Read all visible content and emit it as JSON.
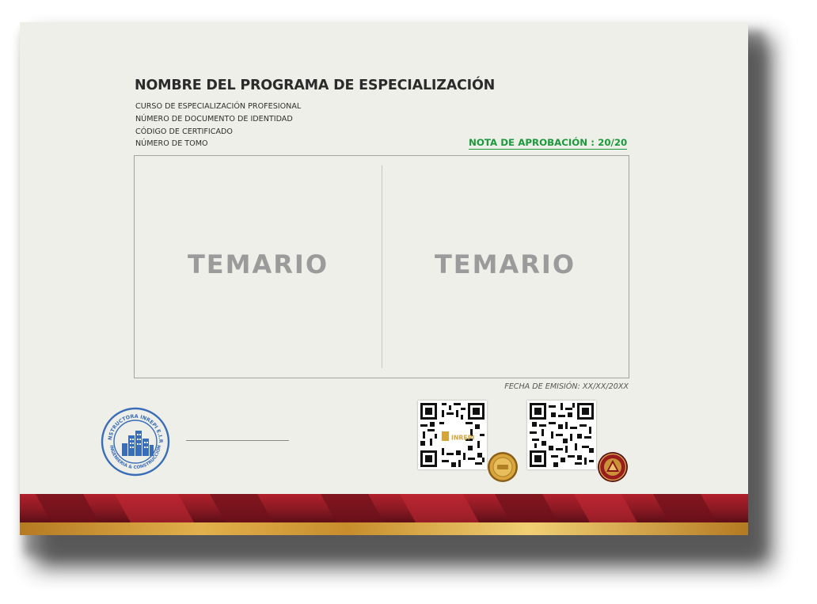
{
  "certificate": {
    "title": "NOMBRE DEL PROGRAMA DE ESPECIALIZACIÓN",
    "lines": [
      "CURSO DE ESPECIALIZACIÓN PROFESIONAL",
      "NÚMERO DE DOCUMENTO DE IDENTIDAD",
      "CÓDIGO DE CERTIFICADO",
      "NÚMERO DE TOMO"
    ],
    "grade": "NOTA DE APROBACIÓN : 20/20",
    "syllabus_left": "TEMARIO",
    "syllabus_right": "TEMARIO",
    "issue_date": "FECHA DE EMISIÓN: XX/XX/20XX"
  },
  "seal": {
    "text_top": "CONSTRUCTORA INREPI E.I.R.L",
    "text_bottom": "INGENIERIA & CONSTRUCCIÓN",
    "color": "#3a6db8"
  },
  "qr_codes": [
    {
      "icon": "qr-code-icon",
      "logo_text": "INREPI"
    },
    {
      "icon": "qr-code-icon"
    }
  ],
  "colors": {
    "paper": "#efefe9",
    "grade_green": "#1a9a3c",
    "band_red": "#9b1e27",
    "band_gold": "#d49a2f"
  }
}
